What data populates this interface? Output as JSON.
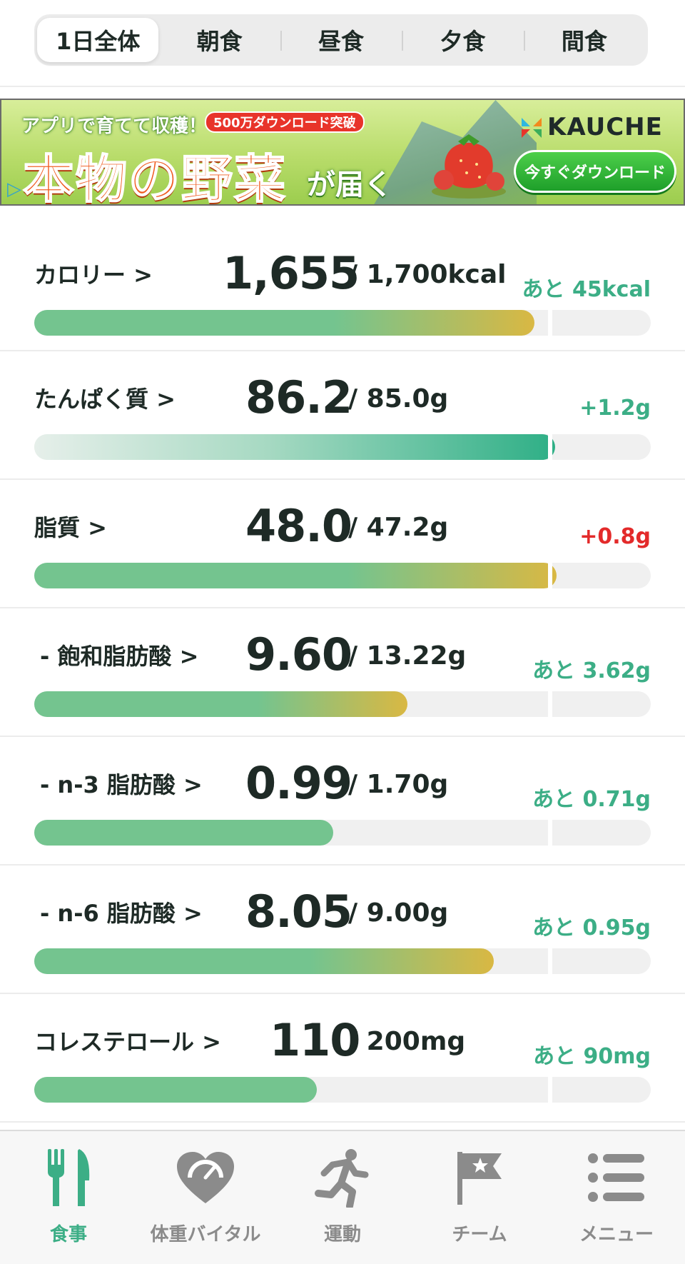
{
  "tabs": [
    {
      "label": "1日全体",
      "active": true
    },
    {
      "label": "朝食",
      "active": false
    },
    {
      "label": "昼食",
      "active": false
    },
    {
      "label": "夕食",
      "active": false
    },
    {
      "label": "間食",
      "active": false
    }
  ],
  "ad": {
    "tagline": "アプリで育てて収穫！",
    "badge": "500万ダウンロード突破",
    "headline": "本物の野菜",
    "headline_sub": "が届く",
    "logo": "KAUCHE",
    "cta": "今すぐダウンロード",
    "colors": {
      "headline": "#f05a1e",
      "cta": "#1e9f2a"
    }
  },
  "nutrients": [
    {
      "label": "カロリー >",
      "value": "1,655",
      "target": "/ 1,700kcal",
      "remain": "あと 45kcal",
      "remain_color": "green",
      "progress_fraction": 0.974,
      "fill_style": "green-yellow"
    },
    {
      "label": "たんぱく質 >",
      "value": "86.2",
      "target": "/ 85.0g",
      "remain": "+1.2g",
      "remain_color": "green",
      "progress_fraction": 1.014,
      "fill_style": "teal-gradient"
    },
    {
      "label": "脂質 >",
      "value": "48.0",
      "target": "/ 47.2g",
      "remain": "+0.8g",
      "remain_color": "red",
      "progress_fraction": 1.017,
      "fill_style": "green-yellow"
    },
    {
      "label": "- 飽和脂肪酸 >",
      "value": "9.60",
      "target": "/ 13.22g",
      "remain": "あと 3.62g",
      "remain_color": "green",
      "progress_fraction": 0.726,
      "fill_style": "green-yellow"
    },
    {
      "label": "- n-3 脂肪酸 >",
      "value": "0.99",
      "target": "/ 1.70g",
      "remain": "あと 0.71g",
      "remain_color": "green",
      "progress_fraction": 0.582,
      "fill_style": "green"
    },
    {
      "label": "- n-6 脂肪酸 >",
      "value": "8.05",
      "target": "/ 9.00g",
      "remain": "あと 0.95g",
      "remain_color": "green",
      "progress_fraction": 0.894,
      "fill_style": "green-yellow"
    },
    {
      "label": "コレステロール >",
      "value": "110",
      "target": "/ 200mg",
      "remain": "あと 90mg",
      "remain_color": "green",
      "progress_fraction": 0.55,
      "fill_style": "green"
    }
  ],
  "bottom_nav": [
    {
      "label": "食事",
      "icon": "fork-knife-icon",
      "active": true
    },
    {
      "label": "体重バイタル",
      "icon": "heart-scale-icon",
      "active": false
    },
    {
      "label": "運動",
      "icon": "runner-icon",
      "active": false
    },
    {
      "label": "チーム",
      "icon": "flag-star-icon",
      "active": false
    },
    {
      "label": "メニュー",
      "icon": "list-menu-icon",
      "active": false
    }
  ],
  "colors": {
    "accent_green": "#3cae86",
    "over_red": "#e32a2a",
    "bar_green": "#74c48f",
    "bar_yellow": "#d9b843",
    "bar_teal": "#2eaf86",
    "track": "#f0f0f0"
  }
}
